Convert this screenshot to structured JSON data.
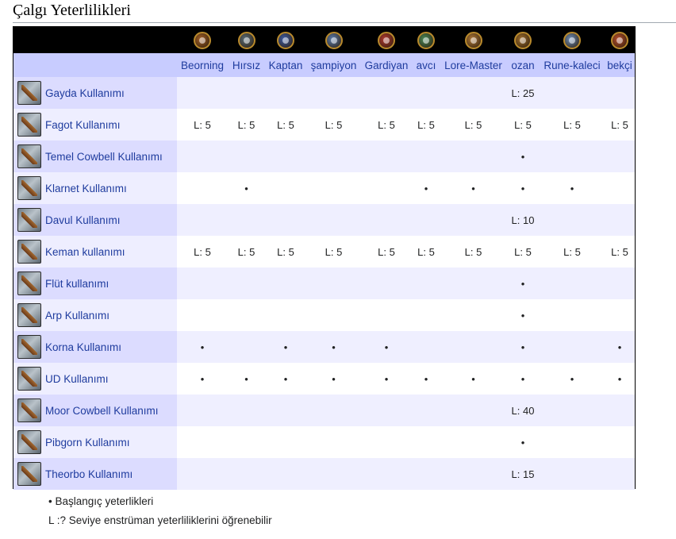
{
  "title": "Çalgı Yeterlilikleri",
  "classes": [
    {
      "name": "Beorning",
      "icon": "beorning-icon",
      "color": "#a5622a"
    },
    {
      "name": "Hırsız",
      "icon": "burglar-icon",
      "color": "#5a6e7a"
    },
    {
      "name": "Kaptan",
      "icon": "captain-icon",
      "color": "#3f5fa8"
    },
    {
      "name": "şampiyon",
      "icon": "champion-icon",
      "color": "#5c7fb0"
    },
    {
      "name": "Gardiyan",
      "icon": "guardian-icon",
      "color": "#b23a32"
    },
    {
      "name": "avcı",
      "icon": "hunter-icon",
      "color": "#4a8a5a"
    },
    {
      "name": "Lore-Master",
      "icon": "lore-master-icon",
      "color": "#b07a3a"
    },
    {
      "name": "ozan",
      "icon": "minstrel-icon",
      "color": "#a07030"
    },
    {
      "name": "Rune-kaleci",
      "icon": "rune-keeper-icon",
      "color": "#6f8fb8"
    },
    {
      "name": "bekçi",
      "icon": "warden-icon",
      "color": "#b8502e"
    }
  ],
  "rows": [
    {
      "name": "Gayda Kullanımı",
      "icon": "bagpipe-icon",
      "cells": [
        "",
        "",
        "",
        "",
        "",
        "",
        "",
        "L: 25",
        "",
        ""
      ]
    },
    {
      "name": "Fagot Kullanımı",
      "icon": "bassoon-icon",
      "cells": [
        "L: 5",
        "L: 5",
        "L: 5",
        "L: 5",
        "L: 5",
        "L: 5",
        "L: 5",
        "L: 5",
        "L: 5",
        "L: 5"
      ]
    },
    {
      "name": "Temel Cowbell Kullanımı",
      "icon": "cowbell-icon",
      "cells": [
        "",
        "",
        "",
        "",
        "",
        "",
        "",
        "•",
        "",
        ""
      ]
    },
    {
      "name": "Klarnet Kullanımı",
      "icon": "clarinet-icon",
      "cells": [
        "",
        "•",
        "",
        "",
        "",
        "•",
        "•",
        "•",
        "•",
        ""
      ]
    },
    {
      "name": "Davul Kullanımı",
      "icon": "drum-icon",
      "cells": [
        "",
        "",
        "",
        "",
        "",
        "",
        "",
        "L: 10",
        "",
        ""
      ]
    },
    {
      "name": "Keman kullanımı",
      "icon": "fiddle-icon",
      "cells": [
        "L: 5",
        "L: 5",
        "L: 5",
        "L: 5",
        "L: 5",
        "L: 5",
        "L: 5",
        "L: 5",
        "L: 5",
        "L: 5"
      ]
    },
    {
      "name": "Flüt kullanımı",
      "icon": "flute-icon",
      "cells": [
        "",
        "",
        "",
        "",
        "",
        "",
        "",
        "•",
        "",
        ""
      ]
    },
    {
      "name": "Arp Kullanımı",
      "icon": "harp-icon",
      "cells": [
        "",
        "",
        "",
        "",
        "",
        "",
        "",
        "•",
        "",
        ""
      ]
    },
    {
      "name": "Korna Kullanımı",
      "icon": "horn-icon",
      "cells": [
        "•",
        "",
        "•",
        "•",
        "•",
        "",
        "",
        "•",
        "",
        "•"
      ]
    },
    {
      "name": "UD Kullanımı",
      "icon": "lute-icon",
      "cells": [
        "•",
        "•",
        "•",
        "•",
        "•",
        "•",
        "•",
        "•",
        "•",
        "•"
      ]
    },
    {
      "name": "Moor Cowbell Kullanımı",
      "icon": "moor-cowbell-icon",
      "cells": [
        "",
        "",
        "",
        "",
        "",
        "",
        "",
        "L: 40",
        "",
        ""
      ]
    },
    {
      "name": "Pibgorn Kullanımı",
      "icon": "pibgorn-icon",
      "cells": [
        "",
        "",
        "",
        "",
        "",
        "",
        "",
        "•",
        "",
        ""
      ]
    },
    {
      "name": "Theorbo Kullanımı",
      "icon": "theorbo-icon",
      "cells": [
        "",
        "",
        "",
        "",
        "",
        "",
        "",
        "L: 15",
        "",
        ""
      ]
    }
  ],
  "legend": {
    "starting": "• Başlangıç yeterlikleri",
    "level": "L :? Seviye enstrüman yeterliliklerini öğrenebilir"
  },
  "colors": {
    "header_bg": "#c8ccff",
    "icon_row_bg": "#000000",
    "link": "#1f3c9e",
    "row_odd": "#efefff",
    "row_even": "#ffffff"
  }
}
